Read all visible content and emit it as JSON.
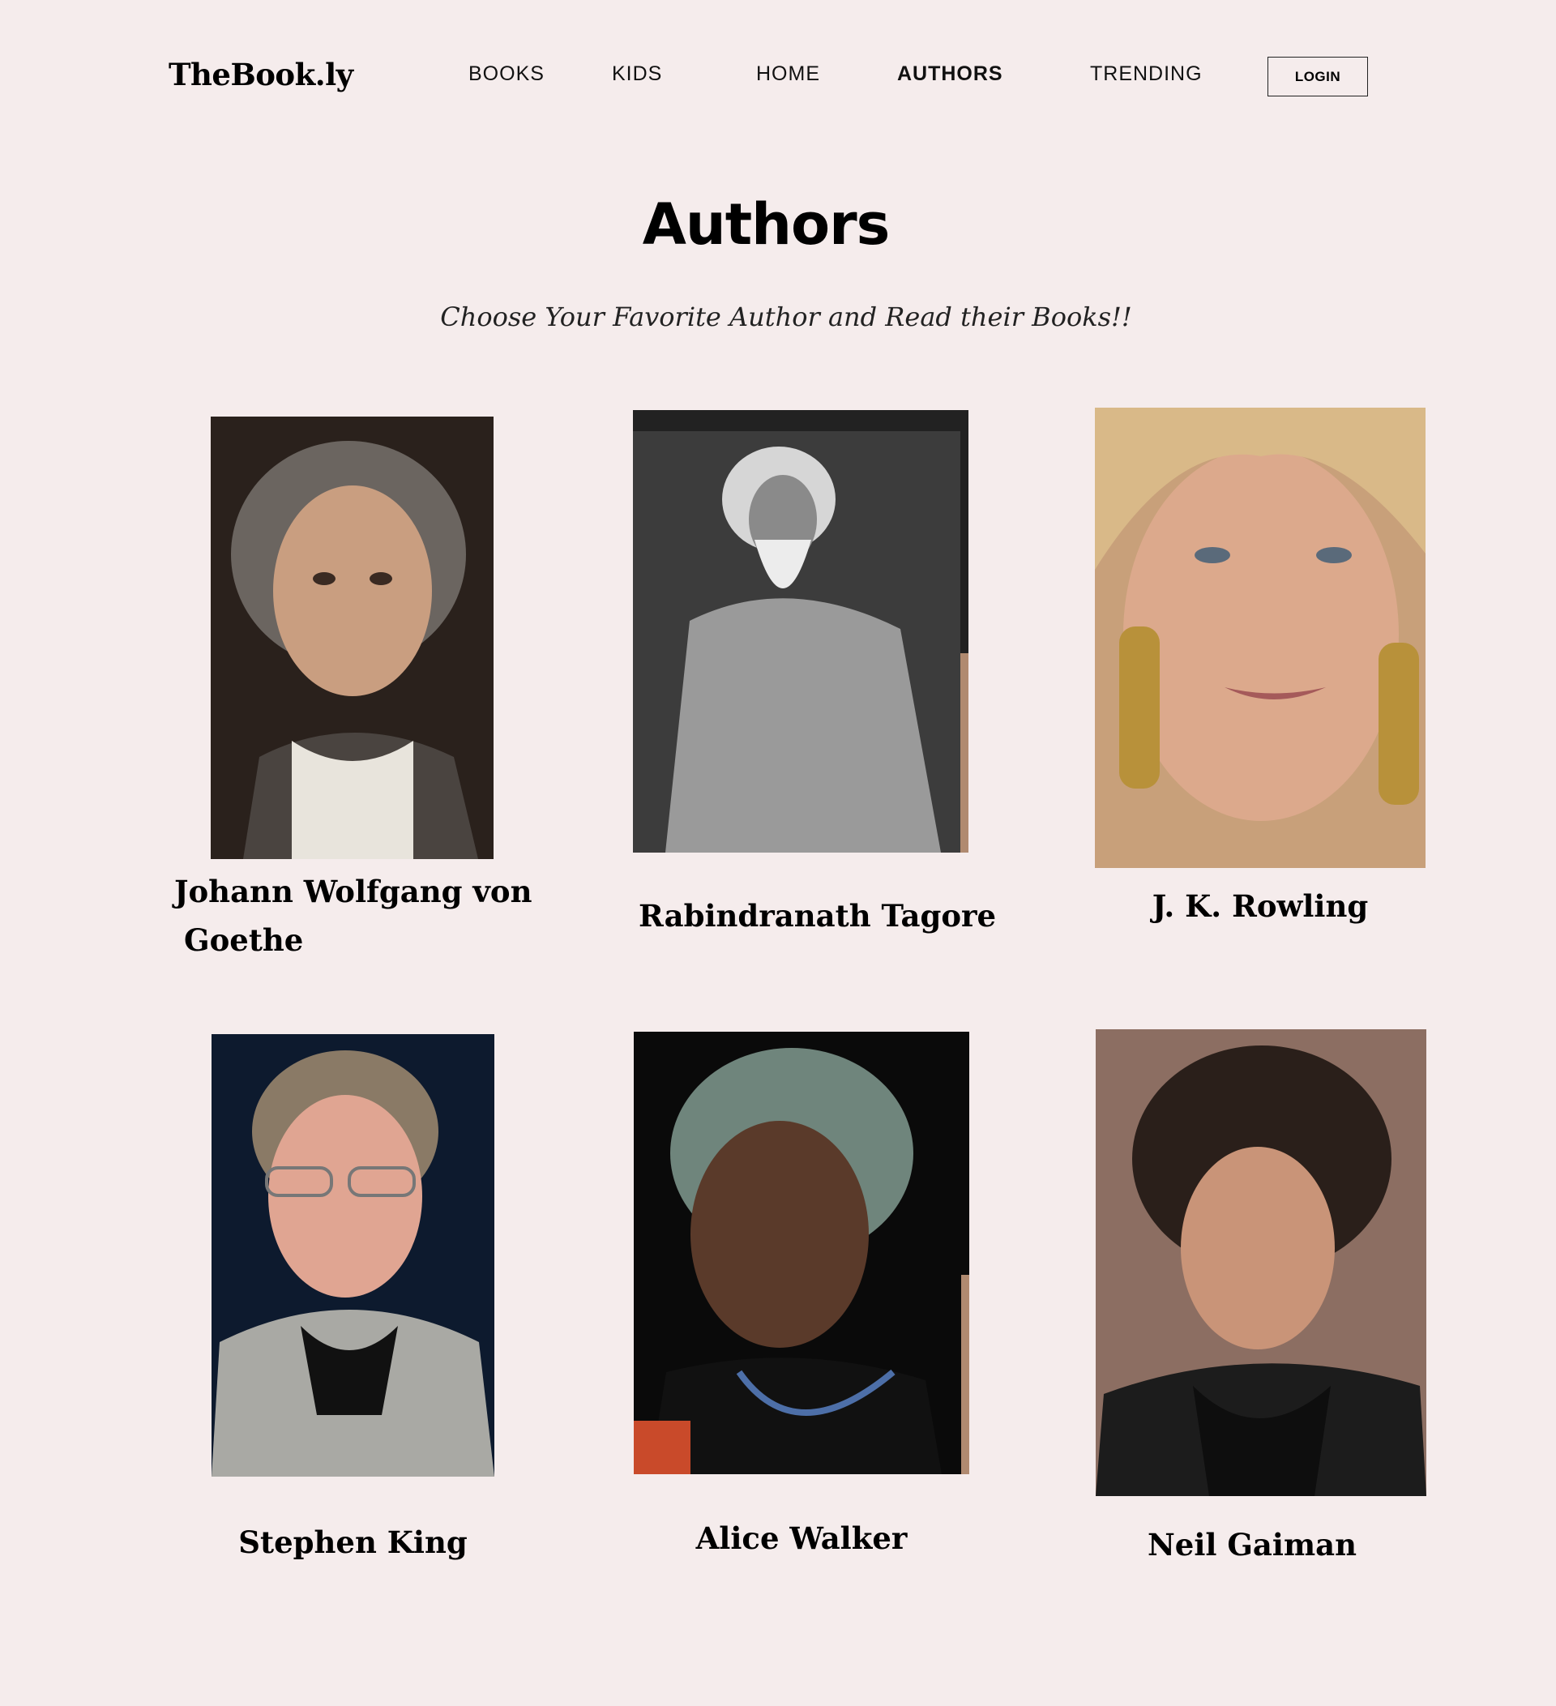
{
  "header": {
    "logo": "TheBook.ly",
    "nav": [
      "BOOKS",
      "KIDS",
      "HOME",
      "AUTHORS",
      "TRENDING"
    ],
    "active_nav": "AUTHORS",
    "login_label": "LOGIN"
  },
  "page": {
    "title": "Authors",
    "subtitle": "Choose Your Favorite Author and Read their Books!!"
  },
  "authors": [
    {
      "name_line1": "Johann Wolfgang von",
      "name_line2": "Goethe",
      "portrait": "goethe-portrait"
    },
    {
      "name": "Rabindranath Tagore",
      "portrait": "tagore-portrait"
    },
    {
      "name": "J. K. Rowling",
      "portrait": "rowling-portrait"
    },
    {
      "name": "Stephen King",
      "portrait": "king-portrait"
    },
    {
      "name": "Alice Walker",
      "portrait": "walker-portrait"
    },
    {
      "name": "Neil Gaiman",
      "portrait": "gaiman-portrait"
    }
  ],
  "colors": {
    "background": "#f5ecec",
    "text": "#000000"
  }
}
